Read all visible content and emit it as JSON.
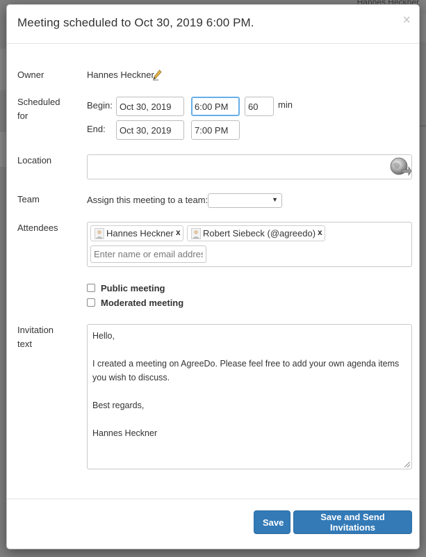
{
  "background": {
    "user_name": "Hannes Heckner"
  },
  "modal": {
    "title": "Meeting scheduled to Oct 30, 2019 6:00 PM.",
    "close_label": "×"
  },
  "owner": {
    "label": "Owner",
    "name": "Hannes Heckner",
    "edit_icon": "pencil-icon"
  },
  "scheduled": {
    "label_line1": "Scheduled",
    "label_line2": "for",
    "begin_label": "Begin:",
    "begin_date": "Oct 30, 2019",
    "begin_time": "6:00 PM",
    "duration": "60",
    "duration_unit": "min",
    "end_label": "End:",
    "end_date": "Oct 30, 2019",
    "end_time": "7:00 PM"
  },
  "location": {
    "label": "Location",
    "value": "",
    "icon": "globe-icon"
  },
  "team": {
    "label": "Team",
    "prompt": "Assign this meeting to a team:",
    "selected": ""
  },
  "attendees": {
    "label": "Attendees",
    "items": [
      {
        "name": "Hannes Heckner",
        "remove": "x"
      },
      {
        "name": "Robert Siebeck (@agreedo)",
        "remove": "x"
      }
    ],
    "input_placeholder": "Enter name or email address"
  },
  "options": {
    "public_label": "Public meeting",
    "moderated_label": "Moderated meeting"
  },
  "invitation": {
    "label_line1": "Invitation",
    "label_line2": "text",
    "lines": [
      "Hello,",
      "",
      "I created a meeting on AgreeDo. Please feel free to add your own agenda items you wish to discuss.",
      "",
      "Best regards,",
      "",
      "Hannes Heckner"
    ]
  },
  "footer": {
    "save_label": "Save",
    "save_send_label": "Save and Send Invitations"
  },
  "colors": {
    "primary": "#337ab7",
    "focus": "#66afe9"
  }
}
